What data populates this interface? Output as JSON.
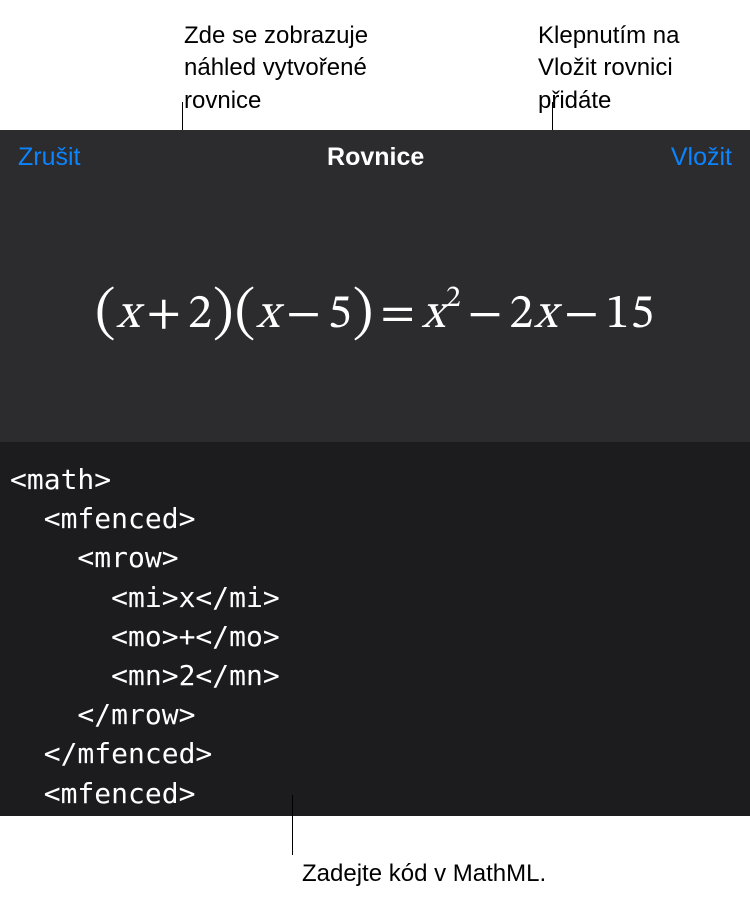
{
  "callouts": {
    "preview": "Zde se zobrazuje náhled vytvořené rovnice",
    "insert": "Klepnutím na Vložit rovnici přidáte",
    "code": "Zadejte kód v MathML."
  },
  "header": {
    "cancel": "Zrušit",
    "title": "Rovnice",
    "insert": "Vložit"
  },
  "equation": {
    "parts": {
      "lp1": "(",
      "x1": "x",
      "plus": "+",
      "two": "2",
      "rp1": ")",
      "lp2": "(",
      "x2": "x",
      "minus1": "−",
      "five": "5",
      "rp2": ")",
      "eq": "=",
      "x3": "x",
      "sq": "2",
      "minus2": "−",
      "twox_coeff": "2",
      "x4": "x",
      "minus3": "−",
      "fifteen": "15"
    }
  },
  "code_text": "<math>\n  <mfenced>\n    <mrow>\n      <mi>x</mi>\n      <mo>+</mo>\n      <mn>2</mn>\n    </mrow>\n  </mfenced>\n  <mfenced>\n    <mrow>"
}
